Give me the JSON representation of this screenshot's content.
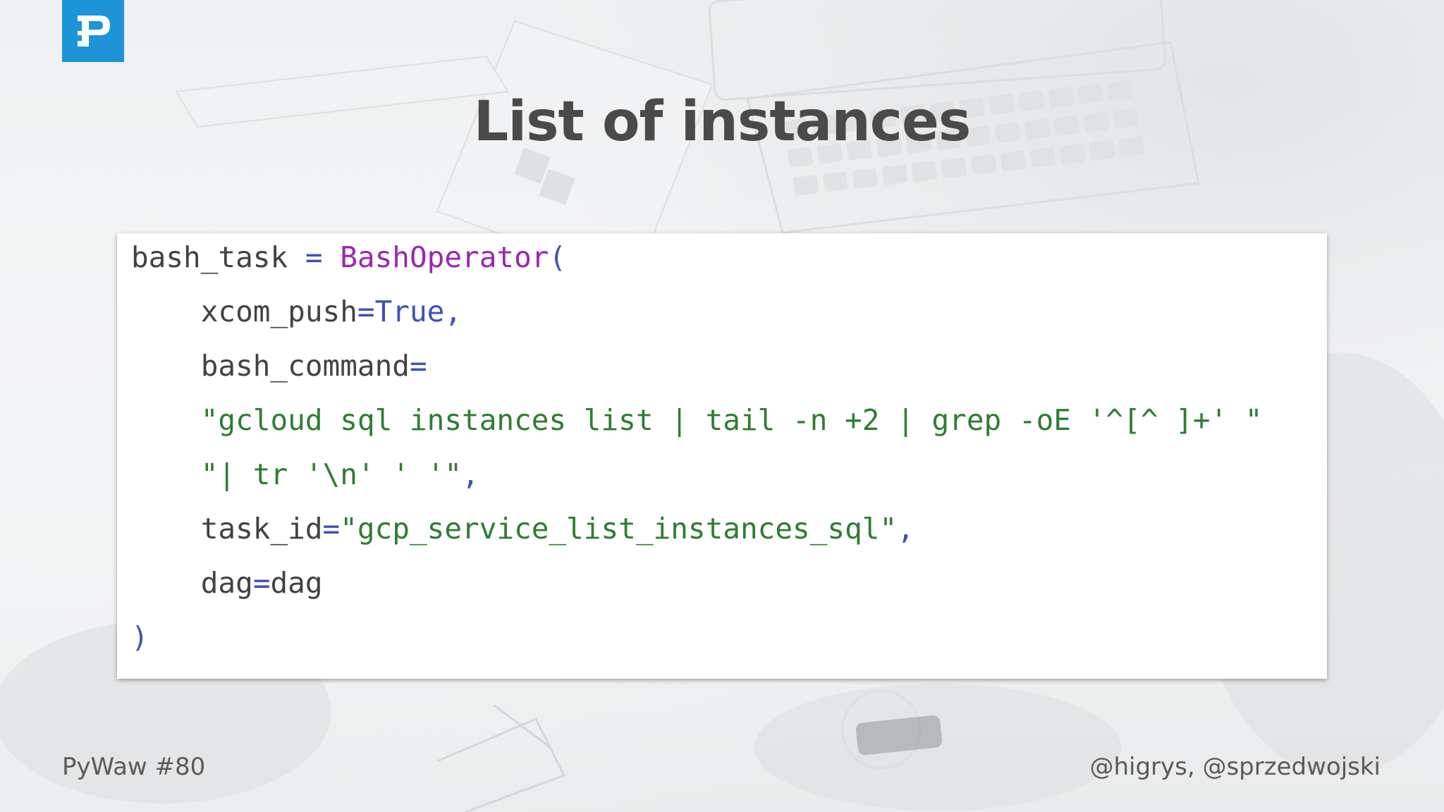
{
  "slide": {
    "title": "List of instances",
    "logo_letter": "P",
    "footer_left": "PyWaw #80",
    "footer_right": "@higrys, @sprzedwojski"
  },
  "code": {
    "line1": {
      "var": "bash_task",
      "eq": " = ",
      "cls": "BashOperator",
      "paren": "("
    },
    "line2": {
      "indent": "    ",
      "arg": "xcom_push",
      "eq": "=",
      "val": "True",
      "comma": ","
    },
    "line3": {
      "indent": "    ",
      "arg": "bash_command",
      "eq": "="
    },
    "line4": {
      "indent": "    ",
      "str": "\"gcloud sql instances list | tail -n +2 | grep -oE '^[^ ]+' \""
    },
    "line5": {
      "indent": "    ",
      "str": "\"| tr '\\n' ' '\"",
      "comma": ","
    },
    "line6": {
      "indent": "    ",
      "arg": "task_id",
      "eq": "=",
      "str": "\"gcp_service_list_instances_sql\"",
      "comma": ","
    },
    "line7": {
      "indent": "    ",
      "arg": "dag",
      "eq": "=",
      "val": "dag"
    },
    "line8": {
      "paren": ")"
    }
  },
  "colors": {
    "logo_bg": "#1d93d8",
    "title": "#4a4a4a",
    "code_class": "#9c27b0",
    "code_keyword": "#3f51b5",
    "code_string": "#2e7d32",
    "code_plain": "#424242"
  }
}
